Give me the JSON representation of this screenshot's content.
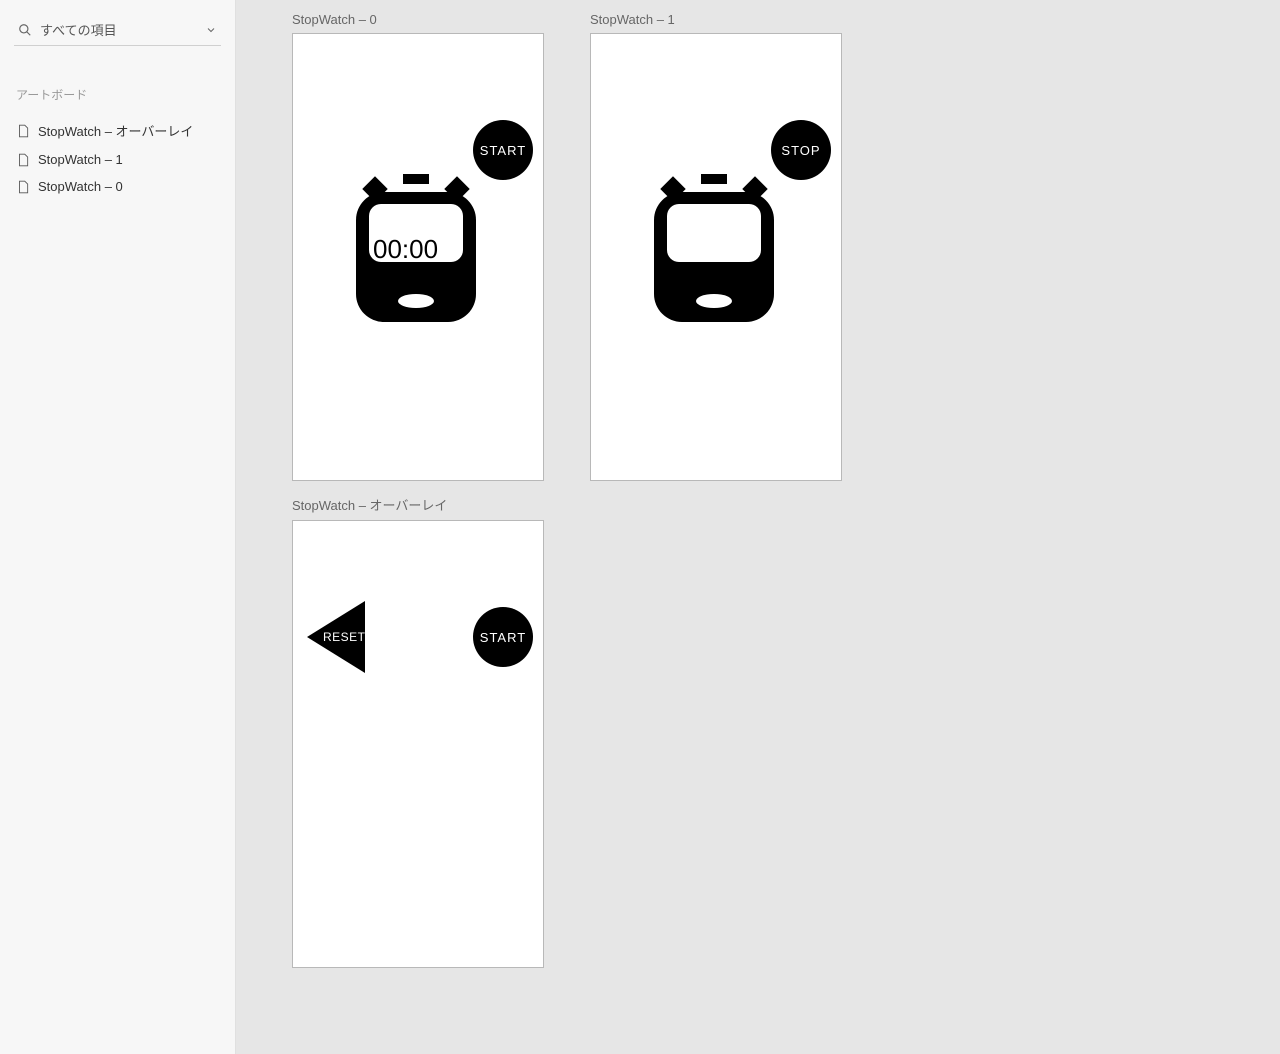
{
  "sidebar": {
    "search_placeholder": "すべての項目",
    "section_label": "アートボード",
    "items": [
      {
        "label": "StopWatch – オーバーレイ"
      },
      {
        "label": "StopWatch – 1"
      },
      {
        "label": "StopWatch – 0"
      }
    ]
  },
  "artboards": {
    "board0": {
      "title": "StopWatch – 0",
      "button_label": "START",
      "time_display": "00:00"
    },
    "board1": {
      "title": "StopWatch – 1",
      "button_label": "STOP"
    },
    "board2": {
      "title": "StopWatch – オーバーレイ",
      "start_label": "START",
      "reset_label": "RESET"
    }
  }
}
